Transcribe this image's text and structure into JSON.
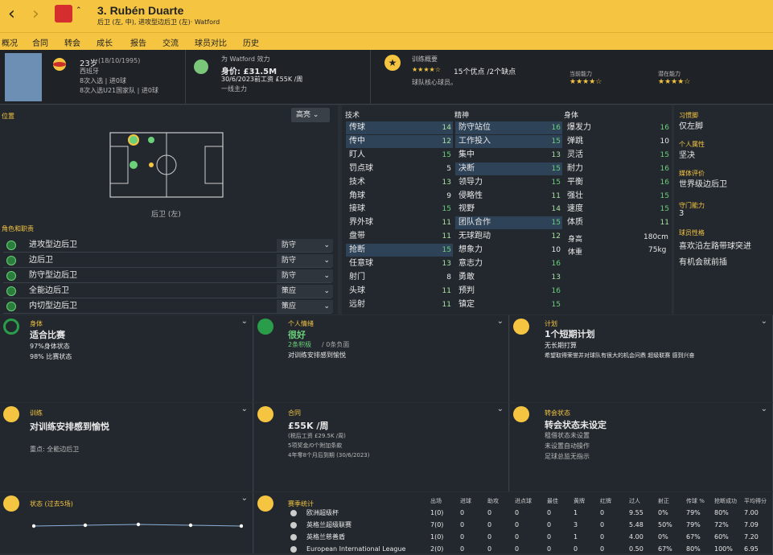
{
  "header": {
    "title": "3. Rubén Duarte",
    "subtitle": "后卫 (左, 中), 进攻型边后卫 (左)· Watford"
  },
  "menu": [
    "概况",
    "合同",
    "转会",
    "成长",
    "报告",
    "交流",
    "球员对比",
    "历史"
  ],
  "profile": {
    "age": "23岁",
    "dob": "(18/10/1995)",
    "nation": "西班牙",
    "caps1": "8次入选 | 进0球",
    "caps2": "8次入选U21国家队 | 进0球",
    "club": "为 Watford 效力",
    "value_label": "身价: £31.5M",
    "contract": "30/6/2023前工资 £55K /周",
    "squad": "一线主力",
    "training_title": "训练概要",
    "training_summary": "15个优点 /2个缺点",
    "training_role": "球队核心球员。",
    "current_ability": "当前能力",
    "potential_ability": "潜在能力"
  },
  "position": {
    "label": "位置",
    "highlight": "高亮",
    "pos_name": "后卫 (左)"
  },
  "attr_headers": {
    "tech": "技术",
    "mental": "精神",
    "physical": "身体"
  },
  "tech": [
    [
      "传球",
      "14"
    ],
    [
      "传中",
      "12"
    ],
    [
      "盯人",
      "15"
    ],
    [
      "罚点球",
      "5"
    ],
    [
      "技术",
      "13"
    ],
    [
      "角球",
      "9"
    ],
    [
      "接球",
      "15"
    ],
    [
      "界外球",
      "11"
    ],
    [
      "盘带",
      "11"
    ],
    [
      "抢断",
      "15"
    ],
    [
      "任意球",
      "13"
    ],
    [
      "射门",
      "8"
    ],
    [
      "头球",
      "11"
    ],
    [
      "远射",
      "11"
    ]
  ],
  "mental": [
    [
      "防守站位",
      "16"
    ],
    [
      "工作投入",
      "15"
    ],
    [
      "集中",
      "13"
    ],
    [
      "决断",
      "15"
    ],
    [
      "领导力",
      "15"
    ],
    [
      "侵略性",
      "11"
    ],
    [
      "视野",
      "14"
    ],
    [
      "团队合作",
      "15"
    ],
    [
      "无球跑动",
      "12"
    ],
    [
      "想象力",
      "10"
    ],
    [
      "意志力",
      "16"
    ],
    [
      "勇敢",
      "13"
    ],
    [
      "预判",
      "16"
    ],
    [
      "镇定",
      "15"
    ]
  ],
  "physical": [
    [
      "爆发力",
      "16"
    ],
    [
      "弹跳",
      "10"
    ],
    [
      "灵活",
      "15"
    ],
    [
      "耐力",
      "16"
    ],
    [
      "平衡",
      "16"
    ],
    [
      "强壮",
      "15"
    ],
    [
      "速度",
      "15"
    ],
    [
      "体质",
      "11"
    ]
  ],
  "body": {
    "height_l": "身高",
    "height": "180cm",
    "weight_l": "体重",
    "weight": "75kg"
  },
  "side": [
    [
      "习惯脚",
      "仅左脚"
    ],
    [
      "个人属性",
      "坚决"
    ],
    [
      "媒体评价",
      "世界级边后卫"
    ],
    [
      "守门能力",
      "3"
    ],
    [
      "球员性格",
      "喜欢沿左路带球突进"
    ]
  ],
  "side_extra": "有机会就前插",
  "roles_title": "角色和职责",
  "roles": [
    [
      "进攻型边后卫",
      "防守"
    ],
    [
      "边后卫",
      "防守"
    ],
    [
      "防守型边后卫",
      "防守"
    ],
    [
      "全能边后卫",
      "策应"
    ],
    [
      "内切型边后卫",
      "策应"
    ]
  ],
  "cards": {
    "c1": {
      "lbl": "身体",
      "t": "适合比赛",
      "a": "97%身体状态",
      "b": "98% 比赛状态"
    },
    "c2": {
      "lbl": "个人情绪",
      "t": "很好",
      "a": "2条积极",
      "a2": "/ 0条负面",
      "b": "对训练安排感到愉悦"
    },
    "c3": {
      "lbl": "计划",
      "t": "1个短期计划",
      "a": "无长期打算",
      "b": "希望取得荣誉并对球队有很大的机会问鼎 超级联赛 感到兴奋"
    },
    "c4": {
      "lbl": "训练",
      "t": "对训练安排感到愉悦",
      "a": "重点: 全能边后卫"
    },
    "c5": {
      "lbl": "合同",
      "t": "£55K /周",
      "a": "(税后工资 £29.5K /周)",
      "b": "5项奖金/0个附加条款",
      "c": "4年零8个月后到期 (30/6/2023)"
    },
    "c6": {
      "lbl": "转会状态",
      "t": "转会状态未设定",
      "a": "租借状态未设置",
      "b": "未设置自动操作",
      "c": "足球总监无指示"
    },
    "c7": {
      "lbl": "状态 (过去5场)"
    },
    "c8": {
      "lbl": "赛季统计"
    }
  },
  "stat_cols": [
    "出场",
    "进球",
    "助攻",
    "进点球",
    "最佳",
    "黄牌",
    "红牌",
    "过人",
    "射正",
    "传球 %",
    "抢断成功",
    "平均得分"
  ],
  "stat_rows": [
    [
      "欧洲超级杯",
      "1(0)",
      "0",
      "0",
      "0",
      "0",
      "1",
      "0",
      "9.55",
      "0%",
      "79%",
      "80%",
      "7.00"
    ],
    [
      "英格兰超级联赛",
      "7(0)",
      "0",
      "0",
      "0",
      "0",
      "3",
      "0",
      "5.48",
      "50%",
      "79%",
      "72%",
      "7.09"
    ],
    [
      "英格兰慈善盾",
      "1(0)",
      "0",
      "0",
      "0",
      "0",
      "1",
      "0",
      "4.00",
      "0%",
      "67%",
      "60%",
      "7.20"
    ],
    [
      "European International League",
      "2(0)",
      "0",
      "0",
      "0",
      "0",
      "0",
      "0",
      "0.50",
      "67%",
      "80%",
      "100%",
      "6.95"
    ]
  ]
}
